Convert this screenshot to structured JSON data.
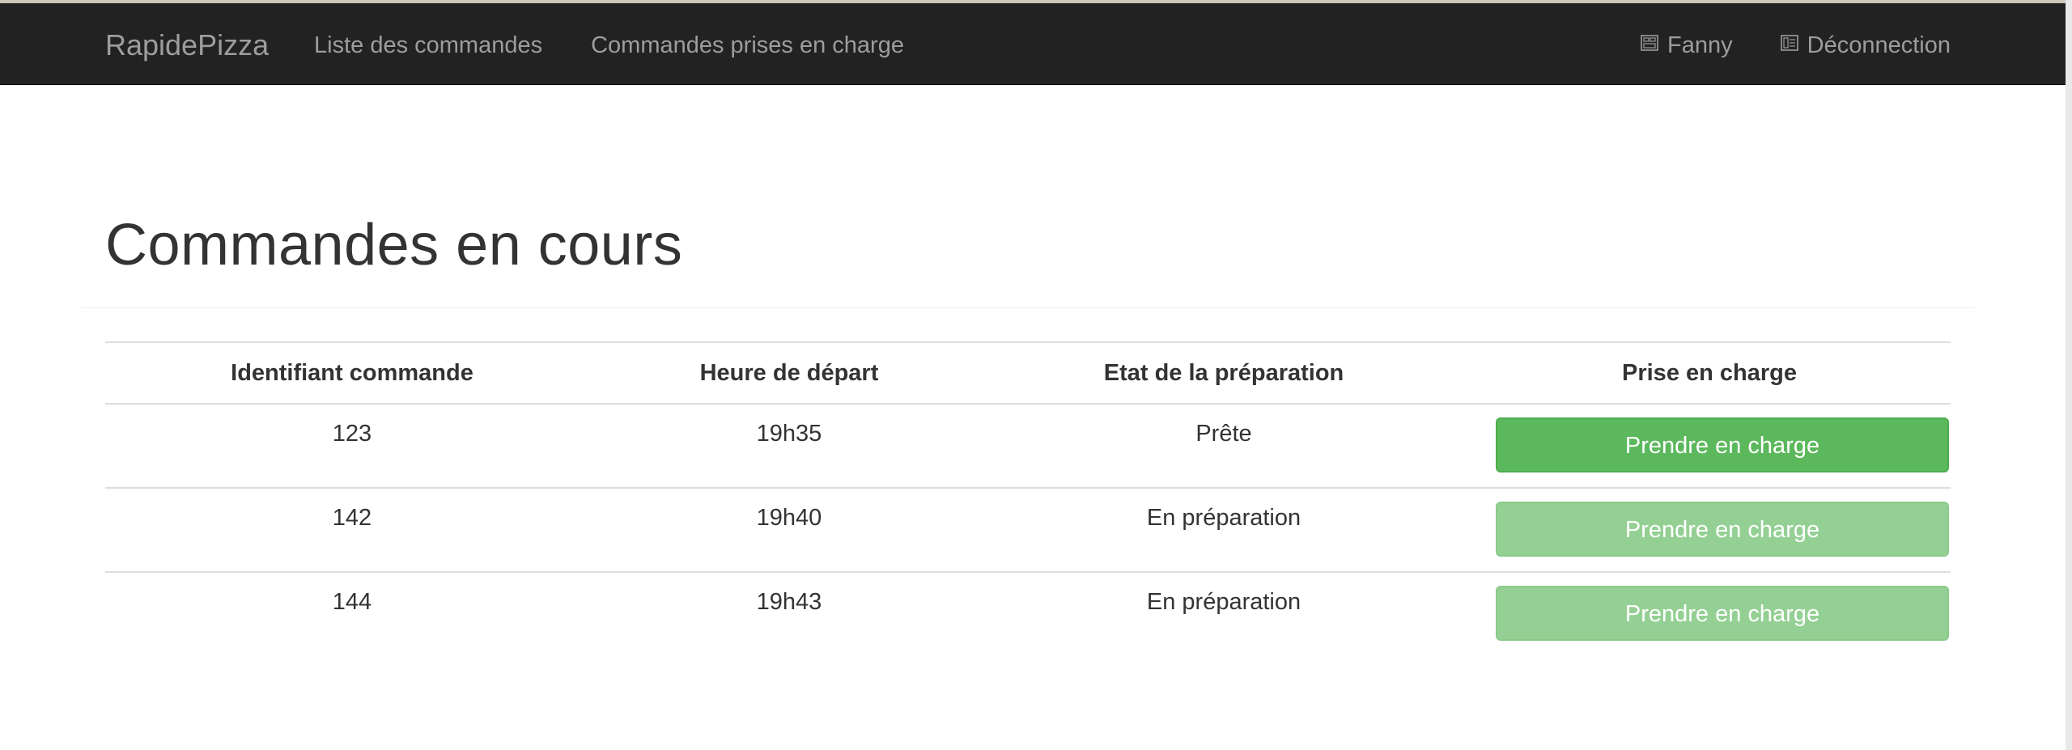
{
  "navbar": {
    "brand": "RapidePizza",
    "links": [
      {
        "label": "Liste des commandes"
      },
      {
        "label": "Commandes prises en charge"
      }
    ],
    "user": {
      "label": "Fanny",
      "icon": "user-icon"
    },
    "logout": {
      "label": "Déconnection",
      "icon": "logout-icon"
    }
  },
  "page": {
    "title": "Commandes en cours"
  },
  "table": {
    "headers": [
      "Identifiant commande",
      "Heure de départ",
      "Etat de la préparation",
      "Prise en charge"
    ],
    "rows": [
      {
        "id": "123",
        "depart": "19h35",
        "etat": "Prête",
        "action": "Prendre en charge",
        "enabled": true
      },
      {
        "id": "142",
        "depart": "19h40",
        "etat": "En préparation",
        "action": "Prendre en charge",
        "enabled": false
      },
      {
        "id": "144",
        "depart": "19h43",
        "etat": "En préparation",
        "action": "Prendre en charge",
        "enabled": false
      }
    ]
  },
  "colors": {
    "navbar_bg": "#222222",
    "nav_text": "#9d9d9d",
    "button_success": "#5cb85c"
  }
}
